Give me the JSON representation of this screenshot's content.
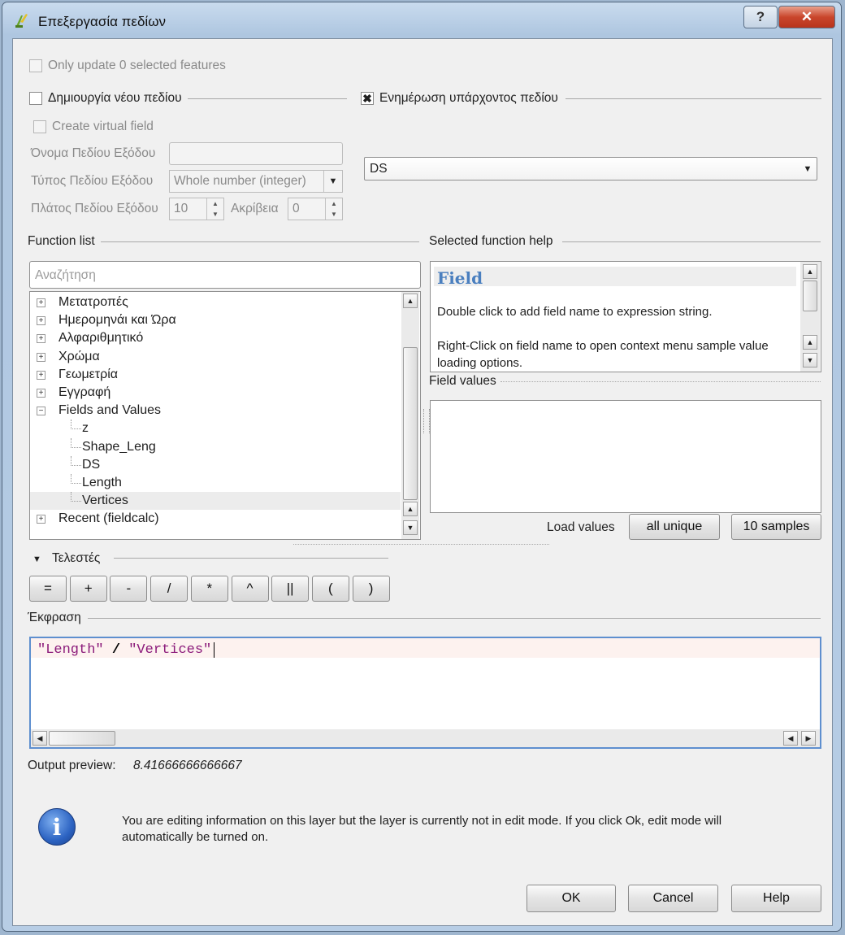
{
  "window": {
    "title": "Επεξεργασία πεδίων",
    "help_glyph": "?",
    "close_glyph": "✕"
  },
  "top": {
    "only_update_label": "Only update 0 selected features"
  },
  "new_field": {
    "group_label": "Δημιουργία νέου πεδίου",
    "virtual_label": "Create virtual field",
    "name_label": "Όνομα Πεδίου Εξόδου",
    "name_value": "",
    "type_label": "Τύπος Πεδίου Εξόδου",
    "type_value": "Whole number (integer)",
    "width_label": "Πλάτος Πεδίου Εξόδου",
    "width_value": "10",
    "precision_label": "Ακρίβεια",
    "precision_value": "0"
  },
  "update_field": {
    "group_label": "Ενημέρωση υπάρχοντος πεδίου",
    "checked_glyph": "✖",
    "selected_field": "DS"
  },
  "function_list": {
    "label": "Function list",
    "search_placeholder": "Αναζήτηση",
    "items": [
      {
        "label": "Μετατροπές",
        "expander": "+"
      },
      {
        "label": "Ημερομηνάι και Ώρα",
        "expander": "+"
      },
      {
        "label": "Αλφαριθμητικό",
        "expander": "+"
      },
      {
        "label": "Χρώμα",
        "expander": "+"
      },
      {
        "label": "Γεωμετρία",
        "expander": "+"
      },
      {
        "label": "Εγγραφή",
        "expander": "+"
      },
      {
        "label": "Fields and Values",
        "expander": "−"
      }
    ],
    "children": [
      "z",
      "Shape_Leng",
      "DS",
      "Length",
      "Vertices"
    ],
    "recent": {
      "label": "Recent (fieldcalc)",
      "expander": "+"
    }
  },
  "help": {
    "label": "Selected function help",
    "title": "Field",
    "line1": "Double click to add field name to expression string.",
    "line2": "Right-Click on field name to open context menu sample value loading options."
  },
  "field_values": {
    "label": "Field values",
    "load_label": "Load values",
    "all_unique": "all unique",
    "samples": "10 samples"
  },
  "operators": {
    "label": "Τελεστές",
    "items": [
      "=",
      "+",
      "-",
      "/",
      "*",
      "^",
      "||",
      "(",
      ")"
    ]
  },
  "expression": {
    "label": "Έκφραση",
    "token1": "\"Length\"",
    "op": "/",
    "token2": "\"Vertices\""
  },
  "preview": {
    "label": "Output preview:",
    "value": "8.41666666666667"
  },
  "info": {
    "icon_glyph": "i",
    "message": "You are editing information on this layer but the layer is currently not in edit mode. If you click Ok, edit mode will automatically be turned on."
  },
  "buttons": {
    "ok": "OK",
    "cancel": "Cancel",
    "help": "Help"
  },
  "colors": {
    "accent_blue": "#5e8fcf",
    "help_title": "#4a7fbf",
    "expr_string": "#8b1a7a",
    "info_icon": "#2c63c2"
  }
}
